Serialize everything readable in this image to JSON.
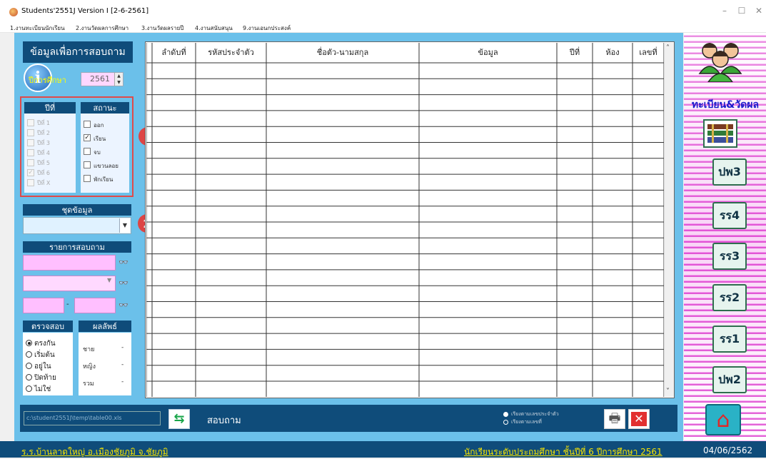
{
  "window": {
    "title": "Students'2551J Version I [2-6-2561]",
    "controls": [
      "–",
      "☐",
      "✕"
    ]
  },
  "menu": [
    "1.งานทะเบียนนักเรียน",
    "2.งานวัดผลการศึกษา",
    "3.งานวัดผลรายปี",
    "4.งานสนับสนุน",
    "9.งานเอนกประสงค์"
  ],
  "left_panel": {
    "title": "ข้อมูลเพื่อการสอบถาม",
    "year_label": "ปีการศึกษา",
    "year_value": "2561",
    "grade_header": "ปีที่",
    "status_header": "สถานะ",
    "grades": [
      {
        "label": "ปีที่ 1",
        "checked": false
      },
      {
        "label": "ปีที่ 2",
        "checked": false
      },
      {
        "label": "ปีที่ 3",
        "checked": false
      },
      {
        "label": "ปีที่ 4",
        "checked": false
      },
      {
        "label": "ปีที่ 5",
        "checked": false
      },
      {
        "label": "ปีที่ 6",
        "checked": true
      },
      {
        "label": "ปีที่ X",
        "checked": false
      }
    ],
    "statuses": [
      {
        "label": "ออก",
        "checked": false
      },
      {
        "label": "เรียน",
        "checked": true
      },
      {
        "label": "จบ",
        "checked": false
      },
      {
        "label": "แขวนลอย",
        "checked": false
      },
      {
        "label": "พักเรียน",
        "checked": false
      }
    ],
    "badge1": "1",
    "badge2": "2",
    "dataset_header": "ชุดข้อมูล",
    "query_items_header": "รายการสอบถาม",
    "range_dash": "-",
    "check_header": "ตรวจสอบ",
    "result_header": "ผลลัพธ์",
    "check_options": [
      {
        "label": "ตรงกัน",
        "selected": true
      },
      {
        "label": "เริ่มต้น",
        "selected": false
      },
      {
        "label": "อยู่ใน",
        "selected": false
      },
      {
        "label": "ปิดท้าย",
        "selected": false
      },
      {
        "label": "ไม่ใช่",
        "selected": false
      }
    ],
    "results": [
      {
        "label": "ชาย",
        "value": "-"
      },
      {
        "label": "หญิง",
        "value": "-"
      },
      {
        "label": "รวม",
        "value": "-"
      }
    ]
  },
  "grid": {
    "columns": [
      "ลำดับที่",
      "รหัสประจำตัว",
      "ชื่อตัว-นามสกุล",
      "ข้อมูล",
      "ปีที่",
      "ห้อง",
      "เลขที่"
    ],
    "row_count": 21,
    "scroll_up": "˄",
    "scroll_down": "˅"
  },
  "bottom_bar": {
    "path": "c:\\student2551J\\temp\\table00.xls",
    "query_label": "สอบถาม",
    "sort_options": [
      "เรียงตามเลขประจำตัว",
      "เรียงตามเลขที่"
    ]
  },
  "right_panel": {
    "title": "ทะเบียน&วัดผล",
    "buttons": [
      "ปพ3",
      "รร4",
      "รร3",
      "รร2",
      "รร1",
      "ปพ2"
    ],
    "home": "⌂"
  },
  "status_bar": {
    "school": "ร.ร.บ้านลาดใหญ่  อ.เมืองชัยภูมิ  จ.ชัยภูมิ",
    "student_info": "นักเรียนระดับประถมศึกษา  ชั้นปีที่ 6  ปีการศึกษา 2561",
    "date": "04/06/2562"
  }
}
